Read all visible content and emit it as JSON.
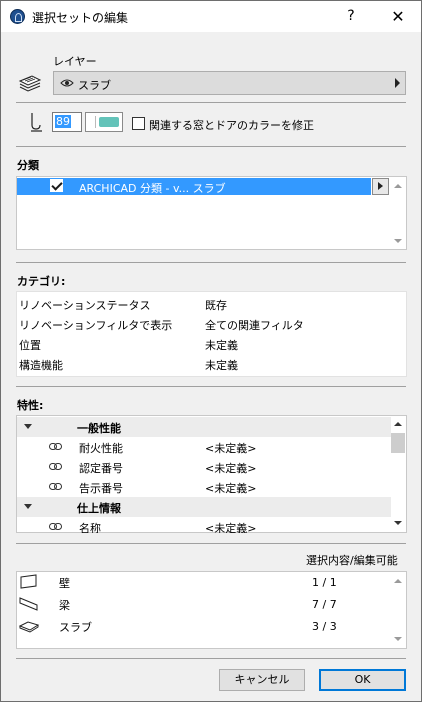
{
  "window": {
    "title": "選択セットの編集",
    "help": "?",
    "close": "✕"
  },
  "layer": {
    "label": "レイヤー",
    "value": "スラブ"
  },
  "pen": {
    "number": "89",
    "checkbox_label": "関連する窓とドアのカラーを修正",
    "checked": false,
    "swatch_color": "#63c3b9"
  },
  "classification": {
    "heading": "分類",
    "selected_item": "ARCHICAD 分類 - v... スラブ",
    "checked": true
  },
  "categories": {
    "heading": "カテゴリ:",
    "rows": [
      {
        "name": "リノベーションステータス",
        "value": "既存"
      },
      {
        "name": "リノベーションフィルタで表示",
        "value": "全ての関連フィルタ"
      },
      {
        "name": "位置",
        "value": "未定義"
      },
      {
        "name": "構造機能",
        "value": "未定義"
      }
    ]
  },
  "properties": {
    "heading": "特性:",
    "rows": [
      {
        "type": "group",
        "name": "一般性能",
        "value": ""
      },
      {
        "type": "item",
        "name": "耐火性能",
        "value": "<未定義>"
      },
      {
        "type": "item",
        "name": "認定番号",
        "value": "<未定義>"
      },
      {
        "type": "item",
        "name": "告示番号",
        "value": "<未定義>"
      },
      {
        "type": "group",
        "name": "仕上情報",
        "value": ""
      },
      {
        "type": "item",
        "name": "名称",
        "value": "<未定義>"
      }
    ]
  },
  "selection": {
    "header": "選択内容/編集可能",
    "rows": [
      {
        "icon": "wall-icon",
        "name": "壁",
        "count": "1 / 1"
      },
      {
        "icon": "beam-icon",
        "name": "梁",
        "count": "7 / 7"
      },
      {
        "icon": "slab-icon",
        "name": "スラブ",
        "count": "3 / 3"
      }
    ]
  },
  "buttons": {
    "cancel": "キャンセル",
    "ok": "OK"
  },
  "colors": {
    "selection": "#3399ff",
    "ok_border": "#0078d7"
  }
}
